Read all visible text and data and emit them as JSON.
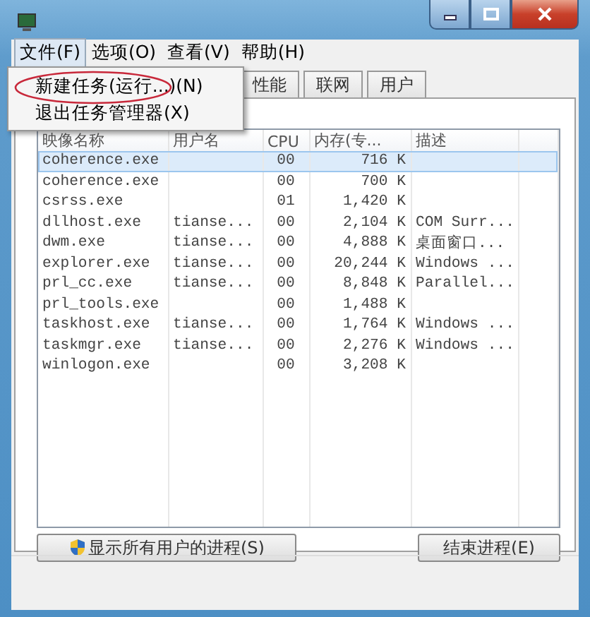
{
  "menubar": [
    {
      "label": "文件(F)",
      "selected": true
    },
    {
      "label": "选项(O)",
      "selected": false
    },
    {
      "label": "查看(V)",
      "selected": false
    },
    {
      "label": "帮助(H)",
      "selected": false
    }
  ],
  "file_menu": {
    "items": [
      {
        "label": "新建任务(运行...)(N)",
        "circled": true
      },
      {
        "label": "退出任务管理器(X)",
        "circled": false
      }
    ]
  },
  "tabs": [
    {
      "label": "性能",
      "selected": false
    },
    {
      "label": "联网",
      "selected": false
    },
    {
      "label": "用户",
      "selected": false
    }
  ],
  "table": {
    "columns": [
      "映像名称",
      "用户名",
      "CPU",
      "内存(专...",
      "描述"
    ],
    "rows": [
      {
        "image": "coherence.exe",
        "cpu": "00",
        "memory": "716 K",
        "selected": true
      },
      {
        "image": "coherence.exe",
        "cpu": "00",
        "memory": "700 K",
        "selected": false
      },
      {
        "image": "csrss.exe",
        "cpu": "01",
        "memory": "1,420 K",
        "selected": false
      },
      {
        "image": "dllhost.exe",
        "user": "tianse...",
        "cpu": "00",
        "memory": "2,104 K",
        "description": "COM Surr...",
        "selected": false
      },
      {
        "image": "dwm.exe",
        "user": "tianse...",
        "cpu": "00",
        "memory": "4,888 K",
        "description": "桌面窗口...",
        "selected": false
      },
      {
        "image": "explorer.exe",
        "user": "tianse...",
        "cpu": "00",
        "memory": "20,244 K",
        "description": "Windows ...",
        "selected": false
      },
      {
        "image": "prl_cc.exe",
        "user": "tianse...",
        "cpu": "00",
        "memory": "8,848 K",
        "description": "Parallel...",
        "selected": false
      },
      {
        "image": "prl_tools.exe",
        "cpu": "00",
        "memory": "1,488 K",
        "selected": false
      },
      {
        "image": "taskhost.exe",
        "user": "tianse...",
        "cpu": "00",
        "memory": "1,764 K",
        "description": "Windows ...",
        "selected": false
      },
      {
        "image": "taskmgr.exe",
        "user": "tianse...",
        "cpu": "00",
        "memory": "2,276 K",
        "description": "Windows ...",
        "selected": false
      },
      {
        "image": "winlogon.exe",
        "cpu": "00",
        "memory": "3,208 K",
        "selected": false
      }
    ]
  },
  "buttons": [
    {
      "label": "显示所有用户的进程(S)",
      "kind": "shield"
    },
    {
      "label": "结束进程(E)",
      "kind": "plain"
    }
  ]
}
